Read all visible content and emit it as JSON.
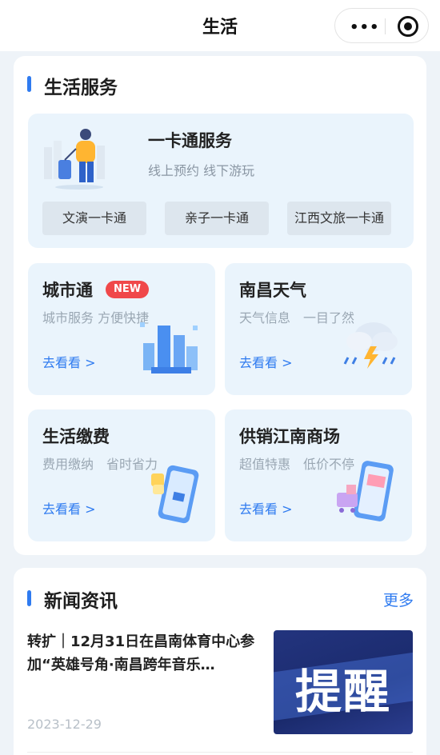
{
  "topbar": {
    "title": "生活",
    "more_icon": "more-dots-icon",
    "close_icon": "target-icon"
  },
  "life_services": {
    "title": "生活服务",
    "yikatong": {
      "title": "一卡通服务",
      "subtitle": "线上预约 线下游玩",
      "buttons": [
        "文演一卡通",
        "亲子一卡通",
        "江西文旅一卡通"
      ]
    },
    "tiles": [
      {
        "title": "城市通",
        "badge": "NEW",
        "subtitle": "城市服务 方便快捷",
        "link": "去看看 >"
      },
      {
        "title": "南昌天气",
        "subtitle": "天气信息　一目了然",
        "link": "去看看 >"
      },
      {
        "title": "生活缴费",
        "subtitle": "费用缴纳　省时省力",
        "link": "去看看 >"
      },
      {
        "title": "供销江南商场",
        "subtitle": "超值特惠　低价不停",
        "link": "去看看 >"
      }
    ]
  },
  "news": {
    "title": "新闻资讯",
    "more": "更多",
    "items": [
      {
        "headline": "转扩｜12月31日在昌南体育中心参加“英雄号角·南昌跨年音乐…",
        "date": "2023-12-29",
        "thumb_text": "提醒"
      }
    ]
  },
  "colors": {
    "accent": "#2f7bf0",
    "badge": "#f0484a",
    "tile_bg": "#eaf4fc"
  }
}
